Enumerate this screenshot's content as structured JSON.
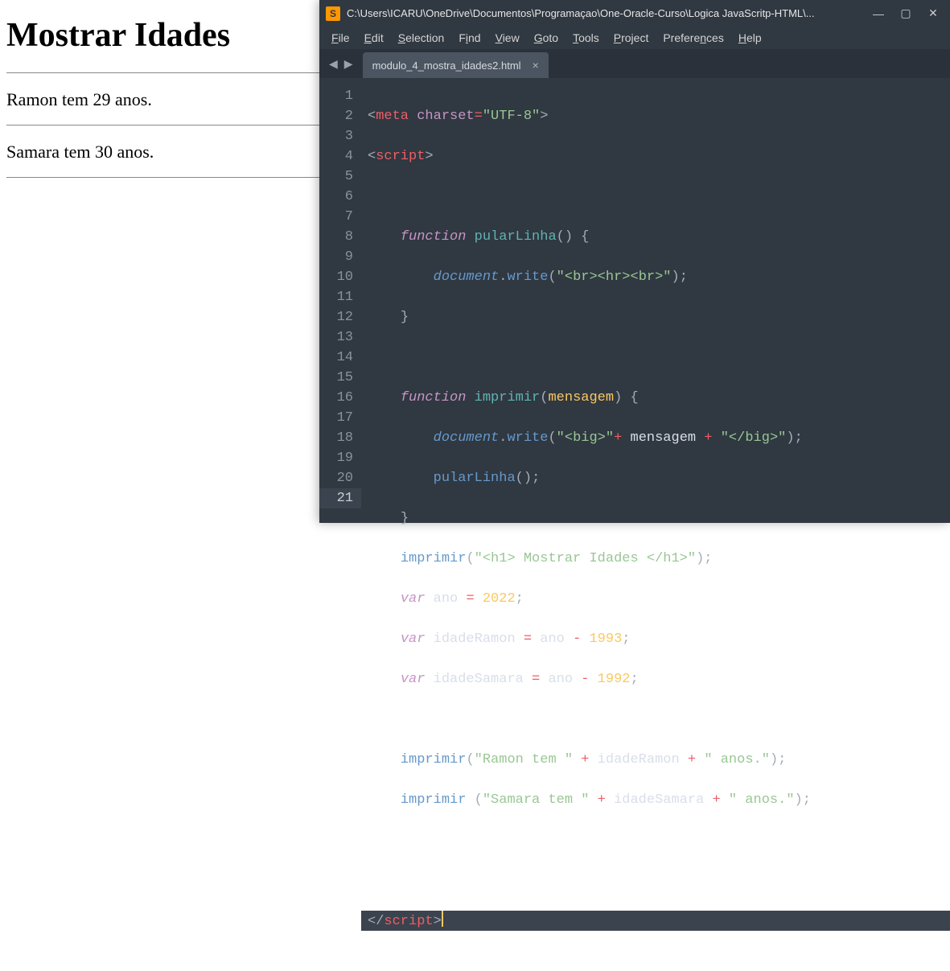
{
  "browser": {
    "heading": "Mostrar Idades",
    "line1": "Ramon tem 29 anos.",
    "line2": "Samara tem 30 anos."
  },
  "editor": {
    "app_icon_letter": "S",
    "title": "C:\\Users\\ICARU\\OneDrive\\Documentos\\Programaçao\\One-Oracle-Curso\\Logica JavaScritp-HTML\\...",
    "win": {
      "min": "—",
      "max": "▢",
      "close": "✕"
    },
    "menu": {
      "file": "File",
      "edit": "Edit",
      "selection": "Selection",
      "find": "Find",
      "view": "View",
      "goto": "Goto",
      "tools": "Tools",
      "project": "Project",
      "preferences": "Preferences",
      "help": "Help"
    },
    "nav": {
      "back": "◀",
      "forward": "▶"
    },
    "tab": {
      "name": "modulo_4_mostra_idades2.html",
      "close": "×"
    },
    "lines": {
      "l1": "1",
      "l2": "2",
      "l3": "3",
      "l4": "4",
      "l5": "5",
      "l6": "6",
      "l7": "7",
      "l8": "8",
      "l9": "9",
      "l10": "10",
      "l11": "11",
      "l12": "12",
      "l13": "13",
      "l14": "14",
      "l15": "15",
      "l16": "16",
      "l17": "17",
      "l18": "18",
      "l19": "19",
      "l20": "20",
      "l21": "21"
    },
    "code": {
      "meta_open": "<",
      "meta_tag": "meta",
      "meta_attr": "charset",
      "meta_eq": "=",
      "meta_val": "\"UTF-8\"",
      "meta_close": ">",
      "script_open": "<",
      "script_tag": "script",
      "script_close": ">",
      "kw_function": "function",
      "fn_pularLinha": "pularLinha",
      "paren_open": "(",
      "paren_close": ")",
      "brace_open": "{",
      "brace_close": "}",
      "doc_obj": "document",
      "dot": ".",
      "write_fn": "write",
      "str_brhrbr": "\"<br><hr><br>\"",
      "semi": ";",
      "fn_imprimir": "imprimir",
      "param_mensagem": "mensagem",
      "str_big_open": "\"<big>\"",
      "plus": "+",
      "id_mensagem": "mensagem",
      "str_big_close": "\"</big>\"",
      "call_pular": "pularLinha",
      "str_h1": "\"<h1> Mostrar Idades </h1>\"",
      "kw_var": "var",
      "id_ano": "ano",
      "eq": "=",
      "num_2022": "2022",
      "id_idadeRamon": "idadeRamon",
      "minus": "-",
      "num_1993": "1993",
      "id_idadeSamara": "idadeSamara",
      "num_1992": "1992",
      "str_ramon": "\"Ramon tem \"",
      "str_anos": "\" anos.\"",
      "str_samara": "\"Samara tem \"",
      "end_script_open": "</",
      "end_script_tag": "script",
      "end_script_close": ">"
    }
  }
}
